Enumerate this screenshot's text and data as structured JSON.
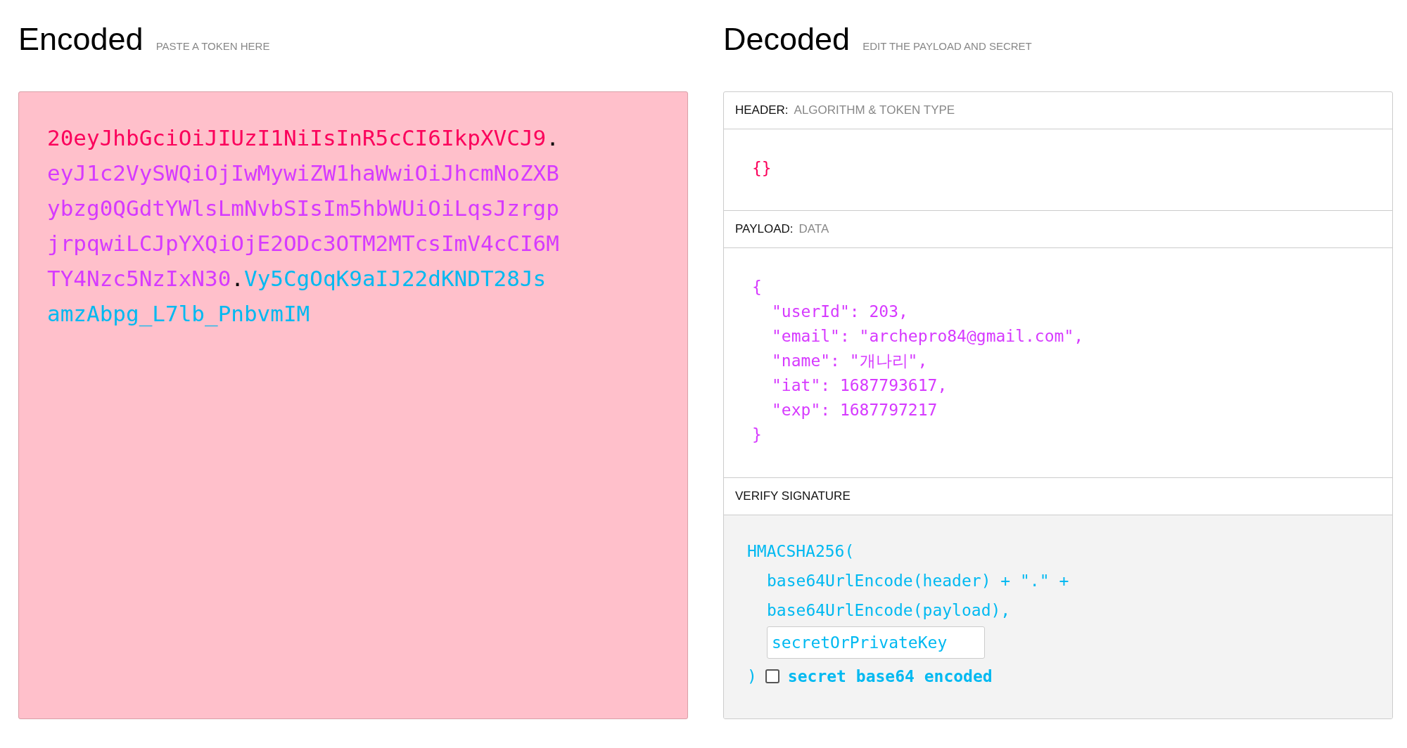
{
  "encoded": {
    "title": "Encoded",
    "subtitle": "PASTE A TOKEN HERE",
    "token": [
      {
        "text": "20eyJhbGciOiJIUzI1NiIsInR5cCI6IkpXVCJ9",
        "color": "#fb015b"
      },
      {
        "text": ".",
        "color": "#000000"
      },
      {
        "text": "eyJ1c2VySWQiOjIwMywiZW1haWwiOiJhcmNoZXBybzg0QGdtYWlsLmNvbSIsIm5hbWUiOiLqsJzrgpjrpqwiLCJpYXQiOjE2ODc3OTM2MTcsImV4cCI6MTY4Nzc5NzIxN30",
        "color": "#d63aff"
      },
      {
        "text": ".",
        "color": "#000000"
      },
      {
        "text": "Vy5CgOqK9aIJ22dKNDT28JsamzAbpg_L7lb_PnbvmIM",
        "color": "#00b9f1"
      }
    ]
  },
  "decoded": {
    "title": "Decoded",
    "subtitle": "EDIT THE PAYLOAD AND SECRET",
    "header": {
      "label": "HEADER:",
      "caption": "ALGORITHM & TOKEN TYPE",
      "lines": [
        {
          "kind": "brace",
          "text": "{}"
        }
      ]
    },
    "payload": {
      "label": "PAYLOAD:",
      "caption": "DATA",
      "lines": [
        {
          "kind": "brace",
          "text": "{"
        },
        {
          "kind": "member",
          "text": "\"userId\": 203,"
        },
        {
          "kind": "member",
          "text": "\"email\": \"archepro84@gmail.com\","
        },
        {
          "kind": "member",
          "text": "\"name\": \"개나리\","
        },
        {
          "kind": "member",
          "text": "\"iat\": 1687793617,"
        },
        {
          "kind": "member",
          "text": "\"exp\": 1687797217"
        },
        {
          "kind": "brace",
          "text": "}"
        }
      ]
    },
    "verify": {
      "label": "VERIFY SIGNATURE",
      "function": "HMACSHA256(",
      "args": [
        "base64UrlEncode(header) + \".\" +",
        "base64UrlEncode(payload),"
      ],
      "secret": {
        "placeholder": "secretOrPrivateKey"
      },
      "close": ")",
      "base64": {
        "label": "secret base64 encoded",
        "checked": false
      }
    }
  }
}
